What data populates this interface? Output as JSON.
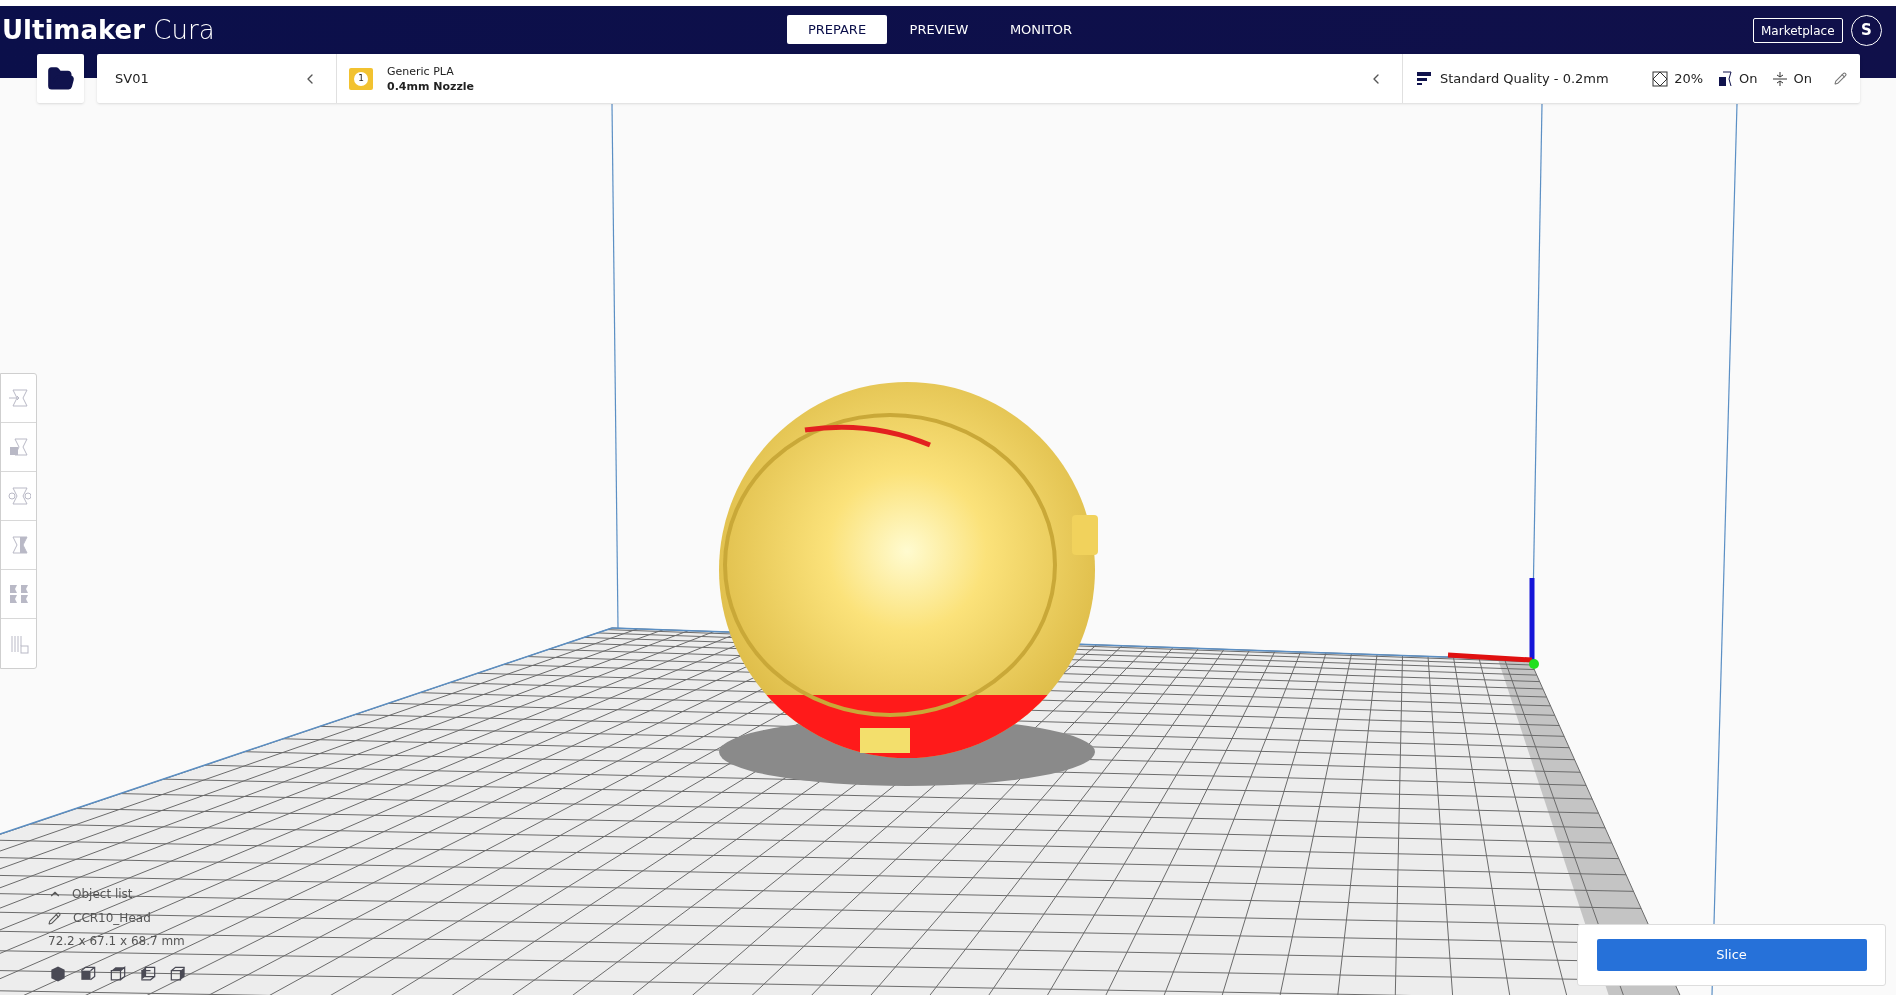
{
  "app": {
    "title_bold": "Ultimaker",
    "title_light": "Cura"
  },
  "stage_tabs": [
    {
      "label": "PREPARE",
      "selected": true
    },
    {
      "label": "PREVIEW",
      "selected": false
    },
    {
      "label": "MONITOR",
      "selected": false
    }
  ],
  "marketplace": "Marketplace",
  "account_initial": "S",
  "printer": {
    "name": "SV01"
  },
  "extruders": [
    {
      "number": "1",
      "material": "Generic PLA",
      "nozzle": "0.4mm Nozzle"
    }
  ],
  "print_settings": {
    "profile": "Standard Quality - 0.2mm",
    "infill": "20%",
    "support": "On",
    "adhesion": "On"
  },
  "object_list": {
    "label": "Object list",
    "expanded": false,
    "objects": [
      {
        "name": "CCR10_Head"
      }
    ],
    "dimensions": "72.2 x 67.1 x 68.7 mm"
  },
  "slice_button": "Slice"
}
